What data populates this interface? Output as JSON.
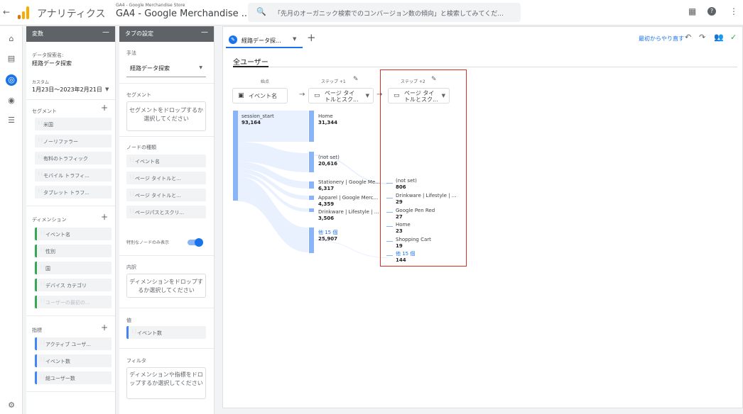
{
  "topbar": {
    "back_icon": "arrow-left-icon",
    "app_name": "アナリティクス",
    "property_sub": "GA4 - Google Merchandise Store",
    "property_main": "GA4 - Google Merchandise ...",
    "search_placeholder": "「先月のオーガニック検索でのコンバージョン数の傾向」と検索してみてくだ...",
    "icons": [
      "apps-grid-icon",
      "help-icon",
      "more-vert-icon"
    ]
  },
  "leftnav": {
    "items": [
      "home-icon",
      "reports-icon",
      "explore-icon",
      "advertising-icon",
      "configure-icon"
    ],
    "settings_icon": "settings-icon"
  },
  "variables": {
    "title": "変数",
    "exploration_name_label": "データ探索名:",
    "exploration_name": "経路データ探索",
    "date_label": "カスタム",
    "date_range": "1月23日～2023年2月21日",
    "segments_label": "セグメント",
    "segments": [
      "米国",
      "ノーリファラー",
      "有料のトラフィック",
      "モバイル トラフィ...",
      "タブレット トラフ..."
    ],
    "dimensions_label": "ディメンション",
    "dimensions": [
      "イベント名",
      "性別",
      "国",
      "デバイス カテゴリ",
      "ユーザーの最初の..."
    ],
    "metrics_label": "指標",
    "metrics": [
      "アクティブ ユーザ...",
      "イベント数",
      "総ユーザー数"
    ]
  },
  "tab_settings": {
    "title": "タブの設定",
    "technique_label": "手法",
    "technique": "経路データ探索",
    "segment_label": "セグメント",
    "segment_drop": "セグメントをドロップするか選択してください",
    "node_type_label": "ノードの種類",
    "node_types": [
      "イベント名",
      "ページ タイトルと...",
      "ページ タイトルと...",
      "ページパスとスクリ..."
    ],
    "unique_nodes_label": "特別なノードのみ表示",
    "breakdown_label": "内訳",
    "breakdown_drop": "ディメンションをドロップするか選択してください",
    "values_label": "値",
    "value_metric": "イベント数",
    "filter_label": "フィルタ",
    "filter_drop": "ディメンションや指標をドロップするか選択してください"
  },
  "main": {
    "tab_label": "経路データ探...",
    "reset_label": "最初からやり直す",
    "segment_title": "全ユーザー",
    "start_label": "始点",
    "step1_label": "ステップ +1",
    "step2_label": "ステップ +2",
    "start_node": "イベント名",
    "step1_node": "ページ タイ トルとスク...",
    "step2_node": "ページ タイ トルとスク...",
    "start": [
      {
        "label": "session_start",
        "value": "93,164"
      }
    ],
    "step1": [
      {
        "label": "Home",
        "value": "31,344"
      },
      {
        "label": "(not set)",
        "value": "20,616"
      },
      {
        "label": "Stationery | Google Me...",
        "value": "6,317"
      },
      {
        "label": "Apparel | Google Merc...",
        "value": "4,359"
      },
      {
        "label": "Drinkware | Lifestyle | ...",
        "value": "3,506"
      },
      {
        "label": "他 15 個",
        "value": "25,907"
      }
    ],
    "step2": [
      {
        "label": "(not set)",
        "value": "806"
      },
      {
        "label": "Drinkware | Lifestyle | ...",
        "value": "29"
      },
      {
        "label": "Google Pen Red",
        "value": "27"
      },
      {
        "label": "Home",
        "value": "23"
      },
      {
        "label": "Shopping Cart",
        "value": "19"
      },
      {
        "label": "他 15 個",
        "value": "144"
      }
    ]
  },
  "colors": {
    "accent": "#1a73e8",
    "node": "#8ab4f8",
    "highlight": "#d93025",
    "dimension": "#34a853",
    "metric": "#4285f4"
  }
}
